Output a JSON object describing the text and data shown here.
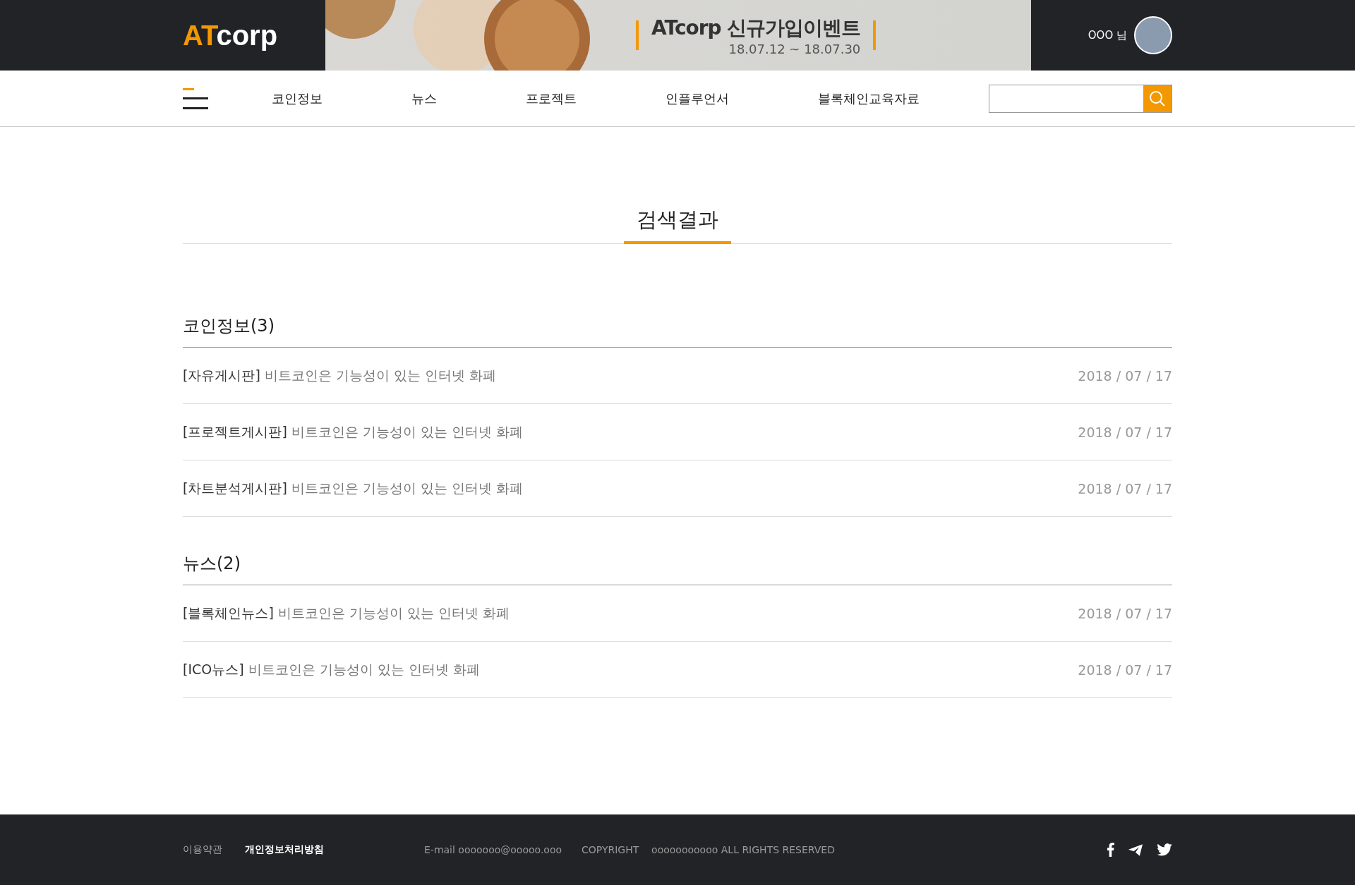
{
  "header": {
    "logo": {
      "accent": "AT",
      "rest": "corp"
    },
    "banner": {
      "title": "ATcorp 신규가입이벤트",
      "dates": "18.07.12 ~ 18.07.30"
    },
    "user": "OOO 님"
  },
  "nav": {
    "items": [
      "코인정보",
      "뉴스",
      "프로젝트",
      "인플루언서",
      "블록체인교육자료"
    ]
  },
  "page_title": "검색결과",
  "sections": [
    {
      "heading": "코인정보(3)",
      "results": [
        {
          "board": "[자유게시판]",
          "title": "비트코인은 기능성이 있는 인터넷 화폐",
          "date": "2018 / 07 / 17"
        },
        {
          "board": "[프로젝트게시판]",
          "title": "비트코인은 기능성이 있는 인터넷 화폐",
          "date": "2018 / 07 / 17"
        },
        {
          "board": "[차트분석게시판]",
          "title": "비트코인은 기능성이 있는 인터넷 화폐",
          "date": "2018 / 07 / 17"
        }
      ]
    },
    {
      "heading": "뉴스(2)",
      "results": [
        {
          "board": "[블록체인뉴스]",
          "title": "비트코인은 기능성이 있는 인터넷 화폐",
          "date": "2018 / 07 / 17"
        },
        {
          "board": "[ICO뉴스]",
          "title": "비트코인은 기능성이 있는 인터넷 화폐",
          "date": "2018 / 07 / 17"
        }
      ]
    }
  ],
  "footer": {
    "links": [
      {
        "label": "이용약관",
        "selected": false
      },
      {
        "label": "개인정보처리방침",
        "selected": true
      }
    ],
    "email": "E-mail ooooooo@ooooo.ooo",
    "copyright": "COPYRIGHT    ooooooooooo ALL RIGHTS RESERVED"
  }
}
